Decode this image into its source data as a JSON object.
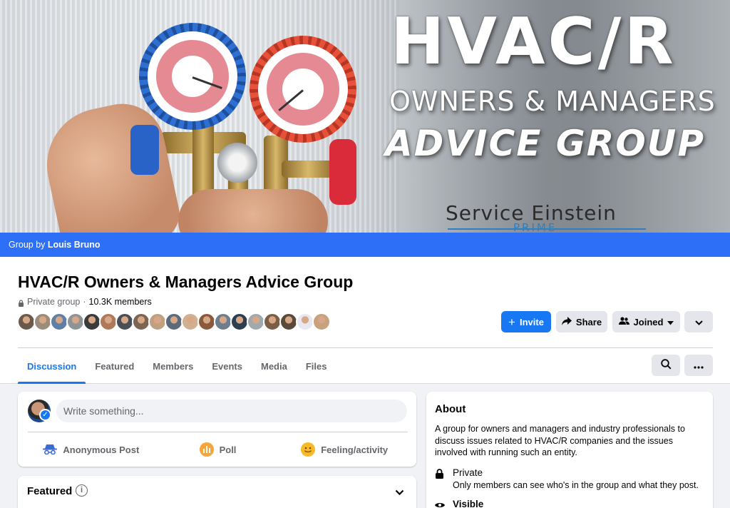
{
  "cover": {
    "line1": "HVAC/R",
    "line2": "OWNERS & MANAGERS",
    "line3": "ADVICE GROUP",
    "brand": "Service Einstein",
    "brand_sub": "PRIME"
  },
  "group_by": {
    "prefix": "Group by ",
    "owner": "Louis Bruno"
  },
  "group": {
    "title": "HVAC/R Owners & Managers Advice Group",
    "privacy": "Private group",
    "separator": " · ",
    "members": "10.3K members"
  },
  "member_avatar_colors": [
    "#6b5a4b",
    "#9c8d7a",
    "#5f7fa6",
    "#8f9499",
    "#3b3b3b",
    "#b07a5a",
    "#4a4f55",
    "#7a6653",
    "#c0a080",
    "#5b6b7b",
    "#d0b090",
    "#8a5a3a",
    "#6d7f8f",
    "#2c3e50",
    "#a0a8b0",
    "#7b5e43",
    "#5a4a3a",
    "#e8e8f0",
    "#c7a27c"
  ],
  "actions": {
    "invite": "Invite",
    "share": "Share",
    "joined": "Joined"
  },
  "tabs": [
    "Discussion",
    "Featured",
    "Members",
    "Events",
    "Media",
    "Files"
  ],
  "composer": {
    "placeholder": "Write something...",
    "options": [
      "Anonymous Post",
      "Poll",
      "Feeling/activity"
    ]
  },
  "featured": {
    "title": "Featured",
    "info": "i"
  },
  "about": {
    "title": "About",
    "description": "A group for owners and managers and industry professionals to discuss issues related to HVAC/R companies and the issues involved with running such an entity.",
    "private_title": "Private",
    "private_desc": "Only members can see who's in the group and what they post.",
    "visible_title": "Visible"
  },
  "colors": {
    "accent": "#1877f2",
    "banner": "#2d6ff7"
  }
}
